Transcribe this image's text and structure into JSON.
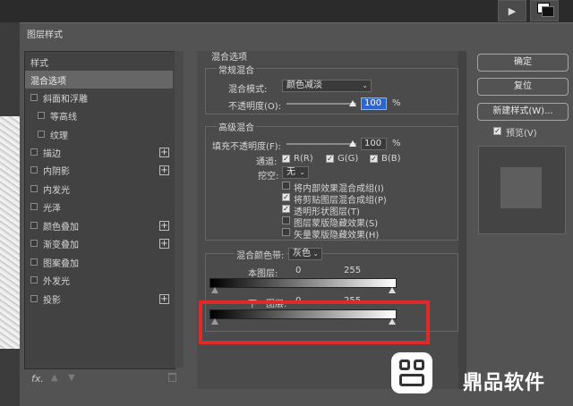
{
  "dialog": {
    "title": "图层样式"
  },
  "style_list": {
    "header": "样式",
    "items": [
      {
        "label": "混合选项",
        "selected": true,
        "checkbox": false,
        "plus": false
      },
      {
        "label": "斜面和浮雕",
        "checkbox": true,
        "plus": false
      },
      {
        "label": "等高线",
        "checkbox": true,
        "indent": true,
        "plus": false
      },
      {
        "label": "纹理",
        "checkbox": true,
        "indent": true,
        "plus": false
      },
      {
        "label": "描边",
        "checkbox": true,
        "plus": true
      },
      {
        "label": "内阴影",
        "checkbox": true,
        "plus": true
      },
      {
        "label": "内发光",
        "checkbox": true,
        "plus": false
      },
      {
        "label": "光泽",
        "checkbox": true,
        "plus": false
      },
      {
        "label": "颜色叠加",
        "checkbox": true,
        "plus": true
      },
      {
        "label": "渐变叠加",
        "checkbox": true,
        "plus": true
      },
      {
        "label": "图案叠加",
        "checkbox": true,
        "plus": false
      },
      {
        "label": "外发光",
        "checkbox": true,
        "plus": false
      },
      {
        "label": "投影",
        "checkbox": true,
        "plus": true
      }
    ],
    "footer_fx": "fx.",
    "plus_symbol": "+"
  },
  "blending": {
    "section_title": "混合选项",
    "general": {
      "title": "常规混合",
      "mode_label": "混合模式:",
      "mode_value": "颜色减淡",
      "opacity_label": "不透明度(O):",
      "opacity_value": "100",
      "opacity_unit": "%"
    },
    "advanced": {
      "title": "高级混合",
      "fill_label": "填充不透明度(F):",
      "fill_value": "100",
      "fill_unit": "%",
      "channels_label": "通道:",
      "channels": [
        {
          "label": "R(R)",
          "checked": true
        },
        {
          "label": "G(G)",
          "checked": true
        },
        {
          "label": "B(B)",
          "checked": true
        }
      ],
      "knockout_label": "挖空:",
      "knockout_value": "无",
      "options": [
        {
          "label": "将内部效果混合成组(I)",
          "checked": false
        },
        {
          "label": "将剪贴图层混合成组(P)",
          "checked": true
        },
        {
          "label": "透明形状图层(T)",
          "checked": true
        },
        {
          "label": "图层蒙版隐藏效果(S)",
          "checked": false
        },
        {
          "label": "矢量蒙版隐藏效果(H)",
          "checked": false
        }
      ]
    },
    "blend_if": {
      "label": "混合颜色带:",
      "value": "灰色",
      "this_layer_label": "本图层:",
      "this_layer_low": "0",
      "this_layer_high": "255",
      "underlying_label": "下一图层:",
      "underlying_low": "0",
      "underlying_high": "255"
    }
  },
  "buttons": {
    "ok": "确定",
    "reset": "复位",
    "new_style": "新建样式(W)...",
    "preview_label": "预览(V)",
    "preview_checked": true
  },
  "watermark": {
    "text": "鼎品软件"
  },
  "colors": {
    "highlight": "#e02a2a",
    "focus_blue": "#2f64c8",
    "dialog_bg": "#535353"
  }
}
